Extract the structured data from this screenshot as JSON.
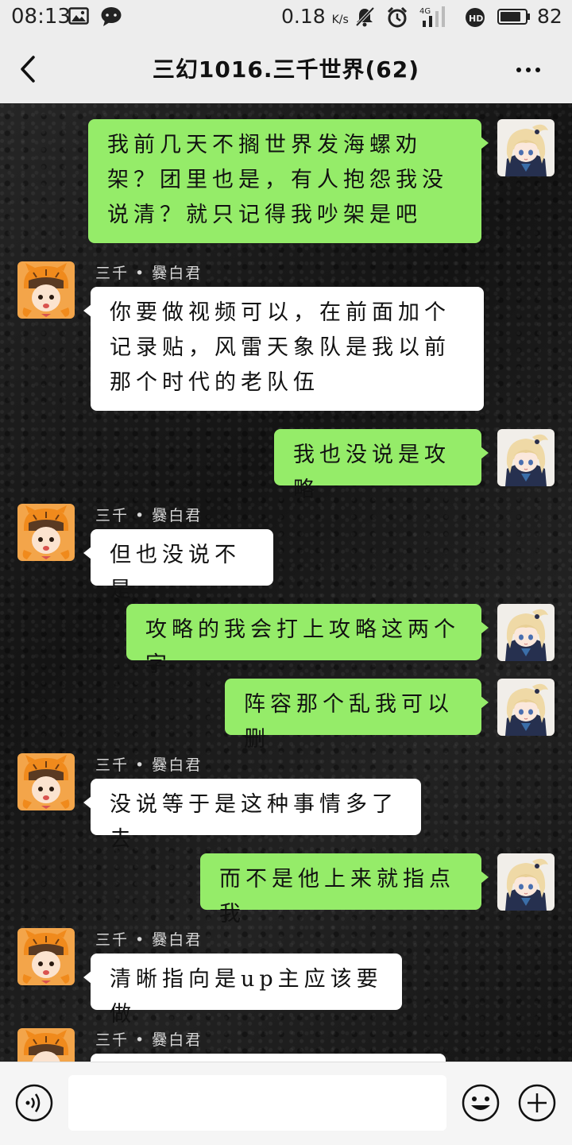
{
  "status_bar": {
    "time": "08:13",
    "speed": "0.18",
    "speed_unit": "K/s",
    "network": "4G",
    "battery": "82",
    "battery_level_percent": 82,
    "icons": [
      "image-icon",
      "chat-bubble-icon",
      "mute-icon",
      "alarm-icon",
      "signal-icon",
      "hd-icon",
      "battery-icon"
    ]
  },
  "header": {
    "title": "三幻1016.三千世界(62)",
    "back_icon": "chevron-left-icon",
    "more_icon": "more-dots-icon"
  },
  "messages": [
    {
      "side": "me",
      "text": "我前几天不搁世界发海螺劝架？团里也是，有人抱怨我没说清？就只记得我吵架是吧"
    },
    {
      "side": "other",
      "sender": "三千 • 爨白君",
      "text": "你要做视频可以，在前面加个记录贴，风雷天象队是我以前那个时代的老队伍"
    },
    {
      "side": "me",
      "text": "我也没说是攻略"
    },
    {
      "side": "other",
      "sender": "三千 • 爨白君",
      "text": "但也没说不是"
    },
    {
      "side": "me",
      "text": "攻略的我会打上攻略这两个字"
    },
    {
      "side": "me",
      "text": "阵容那个乱我可以删"
    },
    {
      "side": "other",
      "sender": "三千 • 爨白君",
      "text": "没说等于是这种事情多了去"
    },
    {
      "side": "me",
      "text": "而不是他上来就指点我"
    },
    {
      "side": "other",
      "sender": "三千 • 爨白君",
      "text": "清晰指向是up主应该要做"
    },
    {
      "side": "other",
      "sender": "三千 • 爨白君",
      "text": ""
    }
  ],
  "input_bar": {
    "value": "",
    "voice_icon": "voice-icon",
    "emoji_icon": "emoji-icon",
    "plus_icon": "plus-icon"
  },
  "colors": {
    "my_bubble": "#95ec69",
    "other_bubble": "#ffffff",
    "chat_background": "#1b1b1b",
    "header_background": "#ededed"
  }
}
